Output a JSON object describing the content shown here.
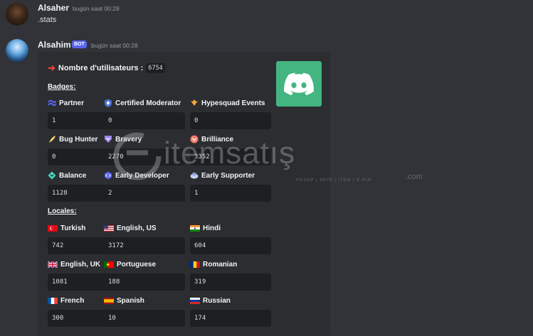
{
  "messages": [
    {
      "author": "Alsaher",
      "timestamp": "bugün saat 00:28",
      "content": ".stats"
    },
    {
      "author": "Alsahim",
      "badge": "BOT",
      "timestamp": "bugün saat 00:28"
    }
  ],
  "embed": {
    "title": "Nombre d'utilisateurs :",
    "title_value": "6754",
    "thumbnail_icon": "discord-logo-icon",
    "thumbnail_color": "#43b581",
    "badges_heading": "Badges:",
    "badges": [
      {
        "name": "Partner",
        "value": "1",
        "icon": "partner-icon"
      },
      {
        "name": "Certified Moderator",
        "value": "0",
        "icon": "certified-moderator-icon"
      },
      {
        "name": "Hypesquad Events",
        "value": "0",
        "icon": "hypesquad-events-icon"
      },
      {
        "name": "Bug Hunter",
        "value": "0",
        "icon": "bug-hunter-icon"
      },
      {
        "name": "Bravery",
        "value": "2270",
        "icon": "bravery-icon"
      },
      {
        "name": "Brilliance",
        "value": "3352",
        "icon": "brilliance-icon"
      },
      {
        "name": "Balance",
        "value": "1128",
        "icon": "balance-icon"
      },
      {
        "name": "Early Developer",
        "value": "2",
        "icon": "early-developer-icon"
      },
      {
        "name": "Early Supporter",
        "value": "1",
        "icon": "early-supporter-icon"
      }
    ],
    "locales_heading": "Locales:",
    "locales": [
      {
        "name": "Turkish",
        "value": "742",
        "icon": "flag-turkey-icon"
      },
      {
        "name": "English, US",
        "value": "3172",
        "icon": "flag-us-icon"
      },
      {
        "name": "Hindi",
        "value": "604",
        "icon": "flag-india-icon"
      },
      {
        "name": "English, UK",
        "value": "1081",
        "icon": "flag-uk-icon"
      },
      {
        "name": "Portuguese",
        "value": "188",
        "icon": "flag-portugal-icon"
      },
      {
        "name": "Romanian",
        "value": "319",
        "icon": "flag-romania-icon"
      },
      {
        "name": "French",
        "value": "300",
        "icon": "flag-france-icon"
      },
      {
        "name": "Spanish",
        "value": "10",
        "icon": "flag-spain-icon"
      },
      {
        "name": "Russian",
        "value": "174",
        "icon": "flag-russia-icon"
      }
    ]
  },
  "watermark": {
    "text": "itemsatış",
    "subtext": "HESAP | SKIN | ITEM | E-PIN",
    "domain": ".com"
  },
  "colors": {
    "background": "#313338",
    "embed": "#2b2d31",
    "accent": "#5865f2",
    "arrow": "#e8413b"
  }
}
